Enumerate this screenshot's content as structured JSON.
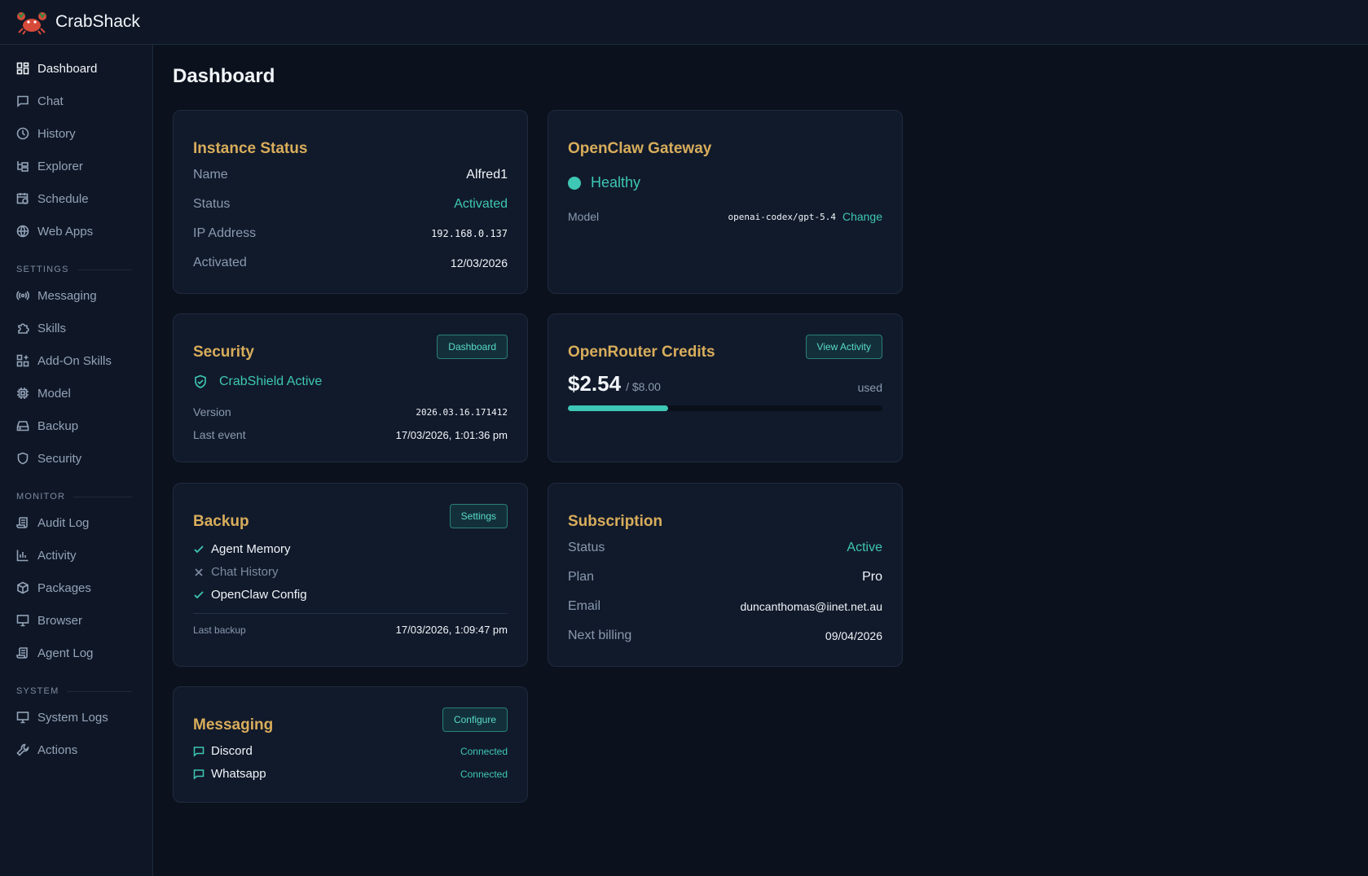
{
  "app": {
    "title": "CrabShack"
  },
  "page": {
    "title": "Dashboard"
  },
  "sidebar": {
    "main": [
      {
        "label": "Dashboard",
        "icon": "dashboard-icon",
        "active": true
      },
      {
        "label": "Chat",
        "icon": "chat-icon"
      },
      {
        "label": "History",
        "icon": "clock-icon"
      },
      {
        "label": "Explorer",
        "icon": "folder-tree-icon"
      },
      {
        "label": "Schedule",
        "icon": "calendar-clock-icon"
      },
      {
        "label": "Web Apps",
        "icon": "globe-icon"
      }
    ],
    "settings_label": "SETTINGS",
    "settings": [
      {
        "label": "Messaging",
        "icon": "broadcast-icon"
      },
      {
        "label": "Skills",
        "icon": "puzzle-icon"
      },
      {
        "label": "Add-On Skills",
        "icon": "grid-plus-icon"
      },
      {
        "label": "Model",
        "icon": "cpu-icon"
      },
      {
        "label": "Backup",
        "icon": "hard-drive-icon"
      },
      {
        "label": "Security",
        "icon": "shield-icon"
      }
    ],
    "monitor_label": "MONITOR",
    "monitor": [
      {
        "label": "Audit Log",
        "icon": "scroll-icon"
      },
      {
        "label": "Activity",
        "icon": "bar-chart-icon"
      },
      {
        "label": "Packages",
        "icon": "package-icon"
      },
      {
        "label": "Browser",
        "icon": "monitor-icon"
      },
      {
        "label": "Agent Log",
        "icon": "scroll-icon"
      }
    ],
    "system_label": "SYSTEM",
    "system": [
      {
        "label": "System Logs",
        "icon": "monitor-icon"
      },
      {
        "label": "Actions",
        "icon": "wrench-icon"
      }
    ]
  },
  "instance": {
    "title": "Instance Status",
    "name_label": "Name",
    "name": "Alfred1",
    "status_label": "Status",
    "status": "Activated",
    "ip_label": "IP Address",
    "ip": "192.168.0.137",
    "activated_label": "Activated",
    "activated": "12/03/2026"
  },
  "gateway": {
    "title": "OpenClaw Gateway",
    "health": "Healthy",
    "model_label": "Model",
    "model": "openai-codex/gpt-5.4",
    "change_label": "Change"
  },
  "security": {
    "title": "Security",
    "button": "Dashboard",
    "shield_status": "CrabShield Active",
    "version_label": "Version",
    "version": "2026.03.16.171412",
    "last_event_label": "Last event",
    "last_event": "17/03/2026, 1:01:36 pm"
  },
  "credits": {
    "title": "OpenRouter Credits",
    "button": "View Activity",
    "used_amount": "$2.54",
    "total": "/ $8.00",
    "used_label": "used",
    "used_fraction": 0.3175
  },
  "backup": {
    "title": "Backup",
    "button": "Settings",
    "items": [
      {
        "label": "Agent Memory",
        "enabled": true
      },
      {
        "label": "Chat History",
        "enabled": false
      },
      {
        "label": "OpenClaw Config",
        "enabled": true
      }
    ],
    "last_backup_label": "Last backup",
    "last_backup": "17/03/2026, 1:09:47 pm"
  },
  "subscription": {
    "title": "Subscription",
    "status_label": "Status",
    "status": "Active",
    "plan_label": "Plan",
    "plan": "Pro",
    "email_label": "Email",
    "email": "duncanthomas@iinet.net.au",
    "next_billing_label": "Next billing",
    "next_billing": "09/04/2026"
  },
  "messaging": {
    "title": "Messaging",
    "button": "Configure",
    "channels": [
      {
        "label": "Discord",
        "status": "Connected"
      },
      {
        "label": "Whatsapp",
        "status": "Connected"
      }
    ]
  },
  "colors": {
    "accent": "#3ec7b4",
    "heading": "#d8ad5b",
    "background": "#0b111d",
    "card": "#111a2b"
  }
}
